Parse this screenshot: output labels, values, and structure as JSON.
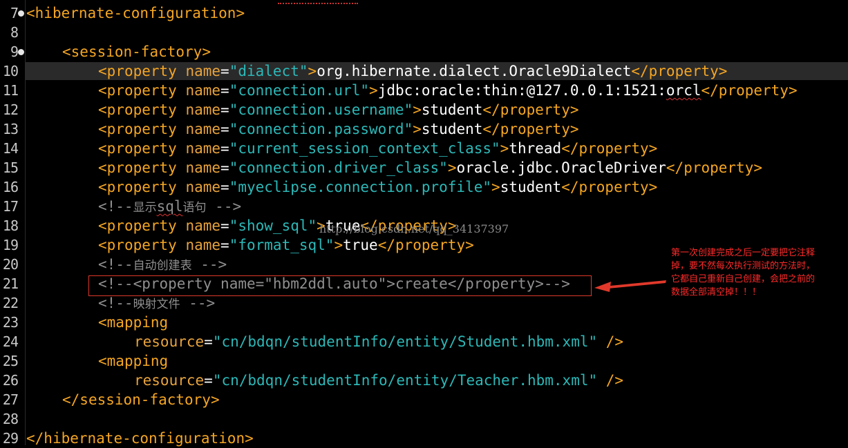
{
  "editor": {
    "lines": [
      {
        "num": "7",
        "fold": true,
        "indent": 0,
        "code": "hibernate-config-open"
      },
      {
        "num": "8"
      },
      {
        "num": "9",
        "fold": true
      },
      {
        "num": "10"
      },
      {
        "num": "11"
      },
      {
        "num": "12"
      },
      {
        "num": "13"
      },
      {
        "num": "14"
      },
      {
        "num": "15"
      },
      {
        "num": "16"
      },
      {
        "num": "17"
      },
      {
        "num": "18"
      },
      {
        "num": "19"
      },
      {
        "num": "20"
      },
      {
        "num": "21"
      },
      {
        "num": "22"
      },
      {
        "num": "23"
      },
      {
        "num": "24"
      },
      {
        "num": "25"
      },
      {
        "num": "26"
      },
      {
        "num": "27"
      },
      {
        "num": "28"
      },
      {
        "num": "29"
      }
    ],
    "tags": {
      "hibernate_configuration": "hibernate-configuration",
      "session_factory": "session-factory",
      "property": "property",
      "mapping": "mapping"
    },
    "attrs": {
      "name": "name",
      "resource": "resource"
    },
    "properties": [
      {
        "name": "dialect",
        "value": "org.hibernate.dialect.Oracle9Dialect"
      },
      {
        "name": "connection.url",
        "value_prefix": "jdbc:oracle:thin:@127.0.0.1:1521:",
        "value_squig": "orcl"
      },
      {
        "name": "connection.username",
        "value": "student"
      },
      {
        "name": "connection.password",
        "value": "student"
      },
      {
        "name": "current_session_context_class",
        "value": "thread"
      },
      {
        "name": "connection.driver_class",
        "value": "oracle.jdbc.OracleDriver"
      },
      {
        "name": "myeclipse.connection.profile",
        "value": "student"
      },
      {
        "name": "show_sql",
        "value": "true"
      },
      {
        "name": "format_sql",
        "value": "true"
      }
    ],
    "comments": {
      "show_sql_before": "显示",
      "show_sql_word": "sql",
      "show_sql_after": "语句",
      "auto_create": "自动创建表",
      "commented_property_name": "hbm2ddl.auto",
      "commented_property_value": "create",
      "mapping_files": "映射文件"
    },
    "mappings": [
      {
        "resource": "cn/bdqn/studentInfo/entity/Student.hbm.xml"
      },
      {
        "resource": "cn/bdqn/studentInfo/entity/Teacher.hbm.xml"
      }
    ],
    "symbols": {
      "comment_open": "<!--",
      "comment_close": "-->",
      "self_close": " />"
    }
  },
  "watermark": "http://blog.csdn.net/qq_34137397",
  "annotation": {
    "text": "第一次创建完成之后一定要把它注释\n掉，要不然每次执行测试的方法时，\n它都自己重新自己创建，会把之前的\n数据全部清空掉！！！",
    "color": "#ff2a2a"
  },
  "colors": {
    "tag": "#f5a623",
    "attribute_value": "#2db8b8",
    "comment": "#8f8f8f",
    "highlight_box": "#e0392b"
  }
}
